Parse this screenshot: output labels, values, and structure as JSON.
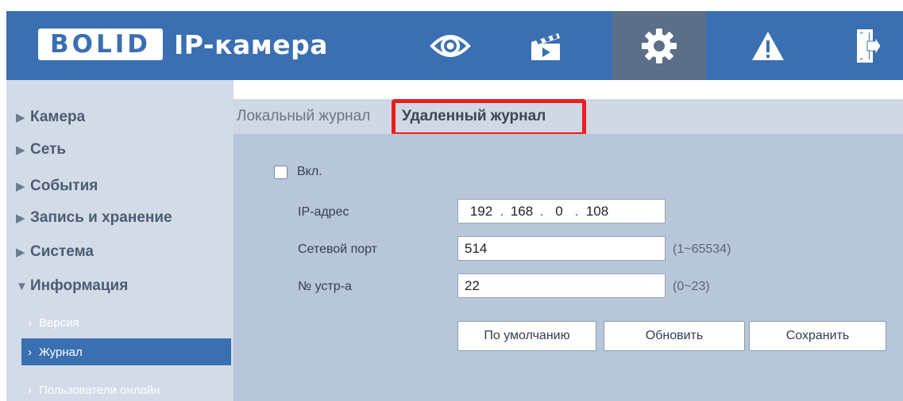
{
  "header": {
    "logo_text": "BOLID",
    "title": "IP-камера",
    "nav": [
      {
        "name": "live-view",
        "icon": "eye-icon"
      },
      {
        "name": "playback",
        "icon": "clapperboard-icon"
      },
      {
        "name": "settings",
        "icon": "gear-icon",
        "active": true
      },
      {
        "name": "alarm",
        "icon": "warning-icon"
      },
      {
        "name": "logout",
        "icon": "exit-icon"
      }
    ],
    "colors": {
      "bar": "#3a6fb2",
      "active": "#5b6f88"
    }
  },
  "sidebar": {
    "items": [
      {
        "label": "Камера",
        "expanded": false
      },
      {
        "label": "Сеть",
        "expanded": false
      },
      {
        "label": "События",
        "expanded": false
      },
      {
        "label": "Запись и хранение",
        "expanded": false
      },
      {
        "label": "Система",
        "expanded": false
      },
      {
        "label": "Информация",
        "expanded": true
      }
    ],
    "subitems": [
      {
        "label": "Версия",
        "active": false
      },
      {
        "label": "Журнал",
        "active": true
      },
      {
        "label": "Пользователи онлайн",
        "active": false
      }
    ]
  },
  "tabs": {
    "local": "Локальный журнал",
    "remote": "Удаленный журнал",
    "active": "remote"
  },
  "form": {
    "enable_label": "Вкл.",
    "enable_checked": false,
    "ip_label": "IP-адрес",
    "ip": [
      "192",
      "168",
      "0",
      "108"
    ],
    "port_label": "Сетевой порт",
    "port_value": "514",
    "port_hint": "(1~65534)",
    "device_label": "№ устр-а",
    "device_value": "22",
    "device_hint": "(0~23)"
  },
  "buttons": {
    "default": "По умолчанию",
    "refresh": "Обновить",
    "save": "Сохранить"
  },
  "highlight_color": "#ee1d1d"
}
